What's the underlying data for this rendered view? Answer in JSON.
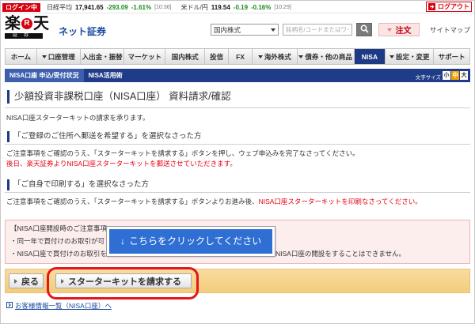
{
  "colors": {
    "brand_red": "#d7000f",
    "nav_active": "#1d3b85",
    "subnav_bg": "#1e3c87",
    "price_down": "#1a8a1a",
    "button_bar": "#f6d38c",
    "callout_blue": "#2f6fd3",
    "highlight_outline": "#e3161e",
    "link_blue": "#1a4b9b"
  },
  "topbar": {
    "login_status": "ログイン中",
    "nikkei": {
      "label": "日経平均",
      "value": "17,941.65",
      "change": "-293.09",
      "change_pct": "-1.61%",
      "time": "[10:36]"
    },
    "usdjpy": {
      "label": "米ドル/円",
      "value": "119.54",
      "change": "-0.19",
      "change_pct": "-0.16%",
      "time": "[10:29]"
    },
    "logout_label": "ログアウト",
    "logout_icon": "logout-icon"
  },
  "header": {
    "logo": {
      "char1": "楽",
      "r_mark": "R",
      "char2": "天",
      "sub": "証券"
    },
    "brand_text": "ネット証券",
    "market_select": "国内株式",
    "search_placeholder": "銘柄名/コードまたはワード名",
    "search_icon": "search-icon",
    "order_label": "注文",
    "sitemap_label": "サイトマップ"
  },
  "nav": {
    "items": [
      {
        "label": "ホーム",
        "dropdown": false
      },
      {
        "label": "口座管理",
        "dropdown": true
      },
      {
        "label": "入出金・振替",
        "dropdown": false
      },
      {
        "label": "マーケット",
        "dropdown": false
      },
      {
        "label": "国内株式",
        "dropdown": false
      },
      {
        "label": "投信",
        "dropdown": false
      },
      {
        "label": "FX",
        "dropdown": false
      },
      {
        "label": "海外株式",
        "dropdown": true
      },
      {
        "label": "債券・他の商品",
        "dropdown": true
      },
      {
        "label": "NISA",
        "dropdown": false,
        "active": true
      },
      {
        "label": "設定・変更",
        "dropdown": true
      },
      {
        "label": "サポート",
        "dropdown": false
      }
    ]
  },
  "subnav": {
    "items": [
      {
        "label": "NISA口座 申込/受付状況",
        "active": true
      },
      {
        "label": "NISA活用術",
        "active": false
      }
    ],
    "font_size_label": "文字サイズ",
    "font_sizes": [
      {
        "label": "小",
        "active": false
      },
      {
        "label": "中",
        "active": true
      },
      {
        "label": "大",
        "active": false
      }
    ]
  },
  "main": {
    "page_title": "少額投資非課税口座（NISA口座） 資料請求/確認",
    "intro": "NISA口座スターターキットの請求を承ります。",
    "sections": [
      {
        "heading": "「ご登録のご住所へ郵送を希望する」を選択なさった方",
        "text": "ご注意事項をご確認のうえ、「スターターキットを請求する」ボタンを押し、ウェブ申込みを完了なさってください。",
        "note_red": "後日、楽天証券よりNISA口座スターターキットを郵送させていただきます。"
      },
      {
        "heading": "「ご自身で印刷する」を選択なさった方",
        "text": "ご注意事項をご確認のうえ、「スターターキットを請求する」ボタンよりお進み後、",
        "text_red": "NISA口座スターターキットを印刷なさってください。"
      }
    ],
    "notice": {
      "heading": "【NISA口座開設時のご注意事項",
      "bullet1": "・同一年で買付けのお取引が可",
      "bullet2_start": "・NISA口座で買付けのお取引を",
      "bullet2_end": "NISA口座の開設をすることはできません。"
    },
    "callout": {
      "arrow": "↓",
      "text": "こちらをクリックしてください"
    },
    "actions": {
      "back_label": "戻る",
      "submit_label": "スターターキットを請求する"
    },
    "footer_link": "お客様情報一覧（NISA口座）へ"
  }
}
